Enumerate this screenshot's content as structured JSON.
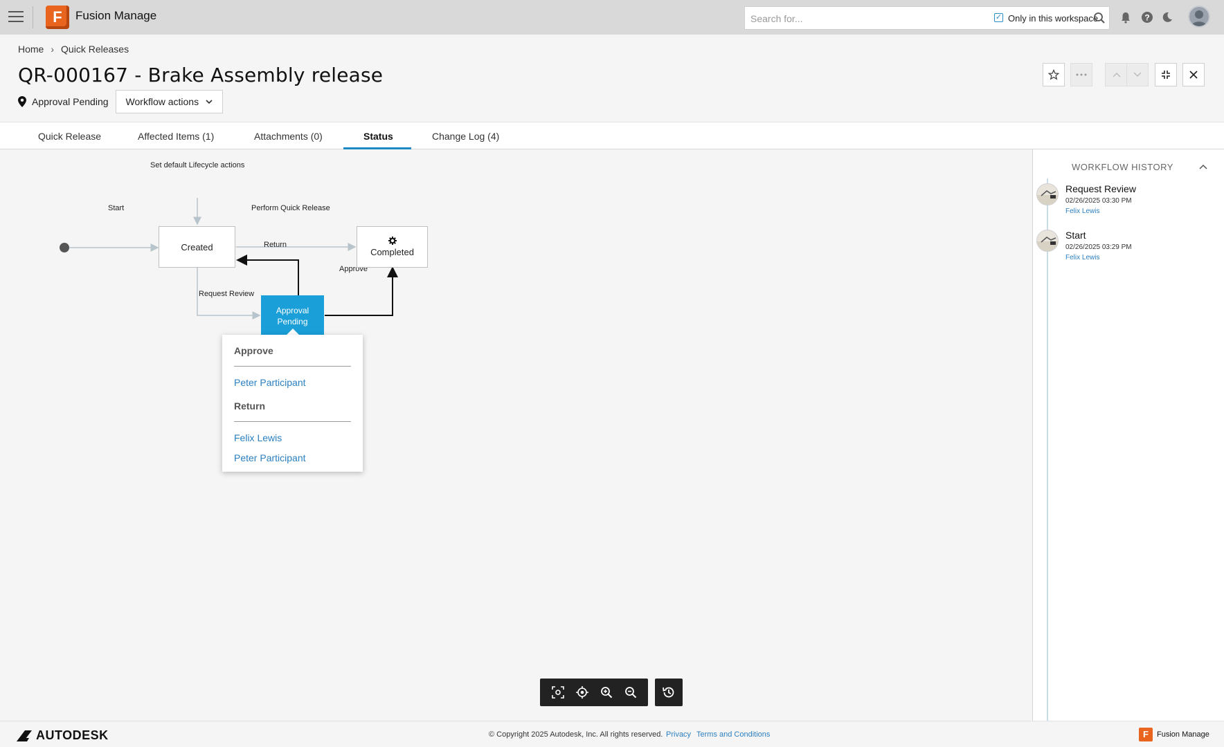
{
  "app": {
    "name": "Fusion Manage",
    "logo_letter": "F"
  },
  "search": {
    "placeholder": "Search for...",
    "workspace_checkbox_label": "Only in this workspace",
    "workspace_checked": true
  },
  "breadcrumb": [
    {
      "label": "Home"
    },
    {
      "label": "Quick Releases"
    }
  ],
  "page": {
    "title": "QR-000167 - Brake Assembly release",
    "current_state": "Approval Pending",
    "workflow_actions_label": "Workflow actions"
  },
  "tabs": [
    {
      "label": "Quick Release"
    },
    {
      "label": "Affected Items (1)"
    },
    {
      "label": "Attachments (0)"
    },
    {
      "label": "Status",
      "active": true
    },
    {
      "label": "Change Log (4)"
    }
  ],
  "workflow": {
    "states": {
      "created": "Created",
      "completed": "Completed",
      "approval_pending": "Approval Pending"
    },
    "transitions": {
      "default_lifecycle": "Set default Lifecycle actions",
      "start": "Start",
      "perform_quick_release": "Perform Quick Release",
      "return": "Return",
      "approve": "Approve",
      "request_review": "Request Review"
    },
    "popover": {
      "sections": [
        {
          "title": "Approve",
          "users": [
            "Peter Participant"
          ]
        },
        {
          "title": "Return",
          "users": [
            "Felix Lewis",
            "Peter Participant"
          ]
        }
      ]
    }
  },
  "history": {
    "title": "WORKFLOW HISTORY",
    "items": [
      {
        "action": "Request Review",
        "date": "02/26/2025 03:30 PM",
        "user": "Felix Lewis"
      },
      {
        "action": "Start",
        "date": "02/26/2025 03:29 PM",
        "user": "Felix Lewis"
      }
    ]
  },
  "footer": {
    "brand": "AUTODESK",
    "copyright": "© Copyright 2025 Autodesk, Inc. All rights reserved.",
    "privacy": "Privacy",
    "terms": "Terms and Conditions",
    "product": "Fusion Manage"
  },
  "colors": {
    "accent": "#1a9fd9",
    "brand_orange": "#e8641f",
    "link": "#2a7fc0"
  }
}
